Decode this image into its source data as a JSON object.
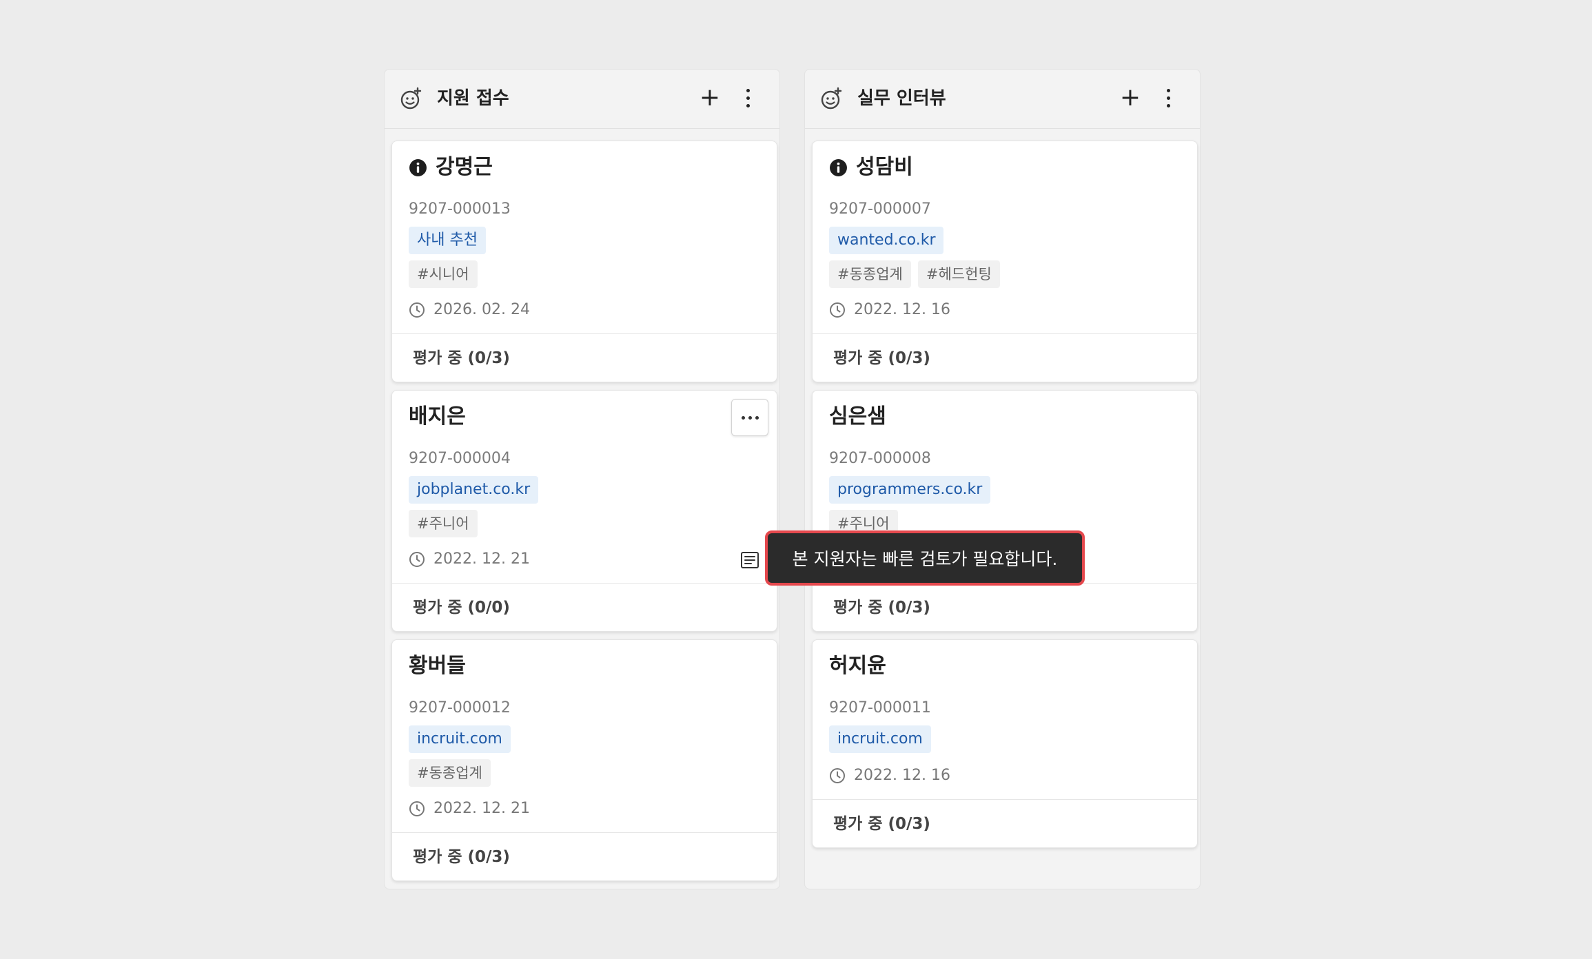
{
  "columns": [
    {
      "title": "지원 접수",
      "icon": "emoji-add-icon",
      "cards": [
        {
          "name": "강명근",
          "has_info_icon": true,
          "id": "9207-000013",
          "source": "사내 추천",
          "tags": [
            "#시니어"
          ],
          "date": "2026. 02. 24",
          "status": "평가 중 (0/3)"
        },
        {
          "name": "배지은",
          "has_info_icon": false,
          "id": "9207-000004",
          "source": "jobplanet.co.kr",
          "tags": [
            "#주니어"
          ],
          "date": "2022. 12. 21",
          "status": "평가 중 (0/0)"
        },
        {
          "name": "황버들",
          "has_info_icon": false,
          "id": "9207-000012",
          "source": "incruit.com",
          "tags": [
            "#동종업계"
          ],
          "date": "2022. 12. 21",
          "status": "평가 중 (0/3)"
        }
      ]
    },
    {
      "title": "실무 인터뷰",
      "icon": "emoji-add-icon",
      "cards": [
        {
          "name": "성담비",
          "has_info_icon": true,
          "id": "9207-000007",
          "source": "wanted.co.kr",
          "tags": [
            "#동종업계",
            "#헤드헌팅"
          ],
          "date": "2022. 12. 16",
          "status": "평가 중 (0/3)"
        },
        {
          "name": "심은샘",
          "has_info_icon": false,
          "id": "9207-000008",
          "source": "programmers.co.kr",
          "tags": [
            "#주니어"
          ],
          "date": "",
          "status": "평가 중 (0/3)"
        },
        {
          "name": "허지윤",
          "has_info_icon": false,
          "id": "9207-000011",
          "source": "incruit.com",
          "tags": [],
          "date": "2022. 12. 16",
          "status": "평가 중 (0/3)"
        }
      ]
    }
  ],
  "tooltip": {
    "text": "본 지원자는 빠른 검토가 필요합니다."
  },
  "colors": {
    "background": "#ececec",
    "source_tag_bg": "#e6f0fa",
    "source_tag_text": "#1f5aa8",
    "tooltip_bg": "#2b2b2b",
    "tooltip_highlight": "#e5484d"
  }
}
